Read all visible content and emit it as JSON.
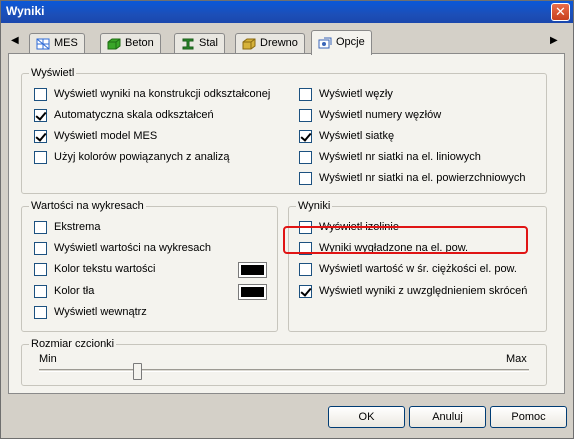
{
  "window": {
    "title": "Wyniki",
    "close_glyph": "✕"
  },
  "nav": {
    "prev_glyph": "◀",
    "next_glyph": "▶"
  },
  "tabs": [
    {
      "label": "MES",
      "icon": "grid-icon",
      "color": "#2f6bd6"
    },
    {
      "label": "Beton",
      "icon": "concrete-icon",
      "color": "#3aa629"
    },
    {
      "label": "Stal",
      "icon": "steel-icon",
      "color": "#2e8f2e"
    },
    {
      "label": "Drewno",
      "icon": "wood-icon",
      "color": "#c09a20"
    },
    {
      "label": "Opcje",
      "icon": "options-icon",
      "color": "#3a66b8",
      "active": true
    }
  ],
  "groups": {
    "display": {
      "title": "Wyświetl",
      "left": [
        {
          "label": "Wyświetl wyniki na konstrukcji odkształconej",
          "checked": false
        },
        {
          "label": "Automatyczna skala odkształceń",
          "checked": true
        },
        {
          "label": "Wyświetl model MES",
          "checked": true
        },
        {
          "label": "Użyj kolorów powiązanych z analizą",
          "checked": false
        }
      ],
      "right": [
        {
          "label": "Wyświetl węzły",
          "checked": false
        },
        {
          "label": "Wyświetl numery węzłów",
          "checked": false
        },
        {
          "label": "Wyświetl siatkę",
          "checked": true
        },
        {
          "label": "Wyświetl nr siatki na el. liniowych",
          "checked": false
        },
        {
          "label": "Wyświetl nr siatki na el. powierzchniowych",
          "checked": false
        }
      ]
    },
    "chart_values": {
      "title": "Wartości na wykresach",
      "items": [
        {
          "label": "Ekstrema",
          "checked": false
        },
        {
          "label": "Wyświetl wartości na wykresach",
          "checked": false
        },
        {
          "label": "Kolor tekstu wartości",
          "checked": false,
          "swatch": "#000000"
        },
        {
          "label": "Kolor tła",
          "checked": false,
          "swatch": "#000000"
        },
        {
          "label": "Wyświetl wewnątrz",
          "checked": false
        }
      ]
    },
    "results": {
      "title": "Wyniki",
      "items": [
        {
          "label": "Wyświetl izolinie",
          "checked": false
        },
        {
          "label": "Wyniki wygładzone na el. pow.",
          "checked": false
        },
        {
          "label": "Wyświetl wartość w śr. ciężkości el. pow.",
          "checked": false
        },
        {
          "label": "Wyświetl wyniki z uwzględnieniem skróceń",
          "checked": true
        }
      ]
    },
    "font_size": {
      "title": "Rozmiar czcionki",
      "min_label": "Min",
      "max_label": "Max",
      "value": 0.2
    }
  },
  "buttons": {
    "ok": "OK",
    "cancel": "Anuluj",
    "help": "Pomoc"
  }
}
